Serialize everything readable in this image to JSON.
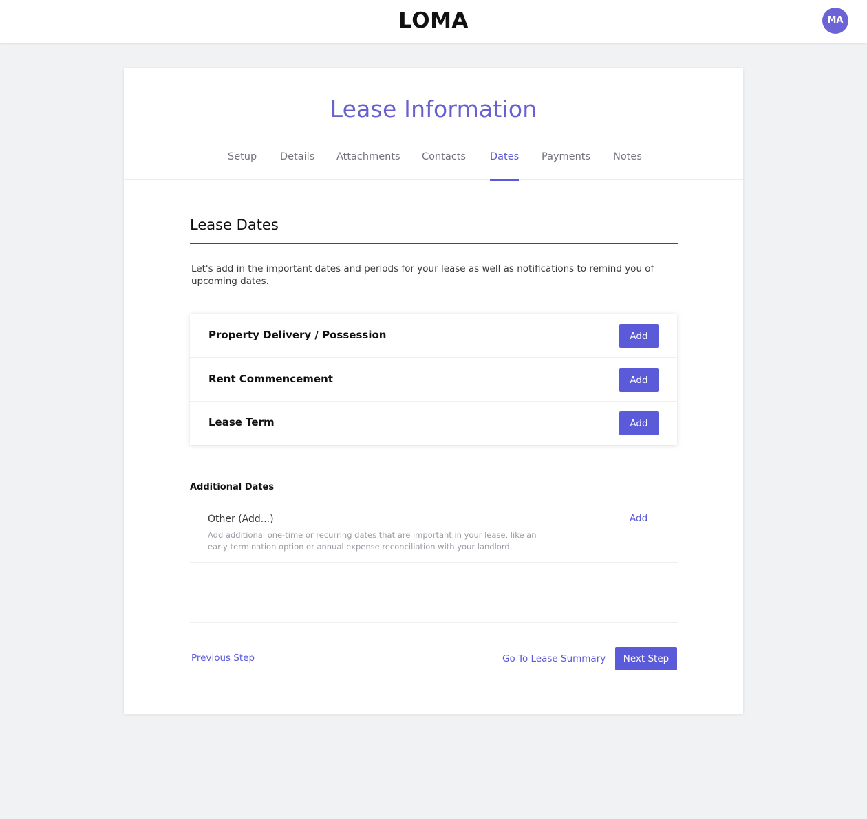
{
  "header": {
    "logo": "LOMA",
    "avatar_initials": "MA"
  },
  "page": {
    "title": "Lease Information",
    "tabs": [
      {
        "label": "Setup",
        "active": false
      },
      {
        "label": "Details",
        "active": false
      },
      {
        "label": "Attachments",
        "active": false
      },
      {
        "label": "Contacts",
        "active": false
      },
      {
        "label": "Dates",
        "active": true
      },
      {
        "label": "Payments",
        "active": false
      },
      {
        "label": "Notes",
        "active": false
      }
    ]
  },
  "section": {
    "title": "Lease Dates",
    "intro": "Let's add in the important dates and periods for your lease as well as notifications to remind you of upcoming dates."
  },
  "dates": [
    {
      "label": "Property Delivery / Possession",
      "button": "Add"
    },
    {
      "label": "Rent Commencement",
      "button": "Add"
    },
    {
      "label": "Lease Term",
      "button": "Add"
    }
  ],
  "additional": {
    "title": "Additional Dates",
    "other_label": "Other (Add...)",
    "other_desc": "Add additional one-time or recurring dates that are important in your lease, like an early termination option or annual expense reconciliation with your landlord.",
    "other_add": "Add"
  },
  "footer": {
    "previous": "Previous Step",
    "summary": "Go To Lease Summary",
    "next": "Next Step"
  },
  "colors": {
    "accent": "#5b5ad8",
    "title": "#6a5fd1",
    "avatar": "#6b63d6",
    "background": "#f1f2f4"
  }
}
